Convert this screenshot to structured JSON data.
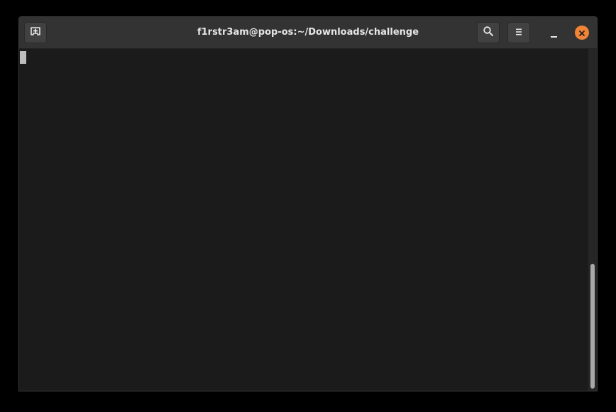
{
  "window": {
    "title": "f1rstr3am@pop-os:~/Downloads/challenge"
  },
  "titlebar": {
    "new_tab_icon": "new-tab-icon",
    "search_icon": "search-icon",
    "menu_icon": "hamburger-menu-icon",
    "minimize_icon": "minimize-icon",
    "close_icon": "close-icon"
  },
  "terminal": {
    "content": ""
  },
  "colors": {
    "titlebar_bg": "#333333",
    "terminal_bg": "#1b1b1b",
    "accent_close": "#f08437",
    "cursor": "#bdbdbd"
  }
}
